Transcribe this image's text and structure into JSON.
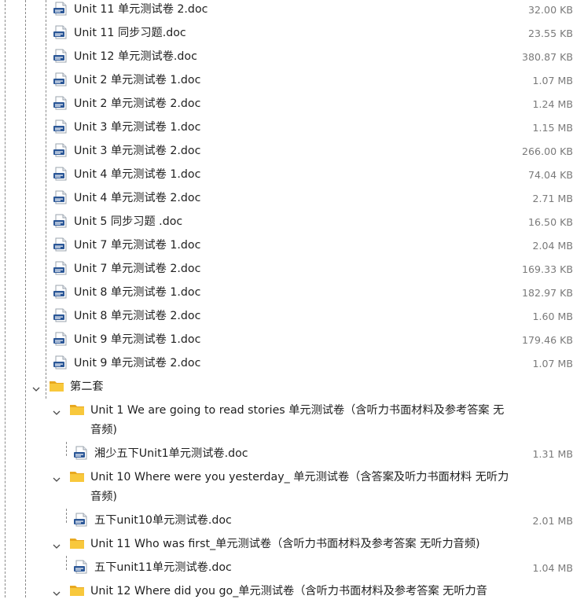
{
  "tree": {
    "items": [
      {
        "kind": "file",
        "depth": 2,
        "name": "Unit 11 单元测试卷 2.doc",
        "size": "32.00 KB"
      },
      {
        "kind": "file",
        "depth": 2,
        "name": "Unit 11 同步习题.doc",
        "size": "23.55 KB"
      },
      {
        "kind": "file",
        "depth": 2,
        "name": "Unit 12 单元测试卷.doc",
        "size": "380.87 KB"
      },
      {
        "kind": "file",
        "depth": 2,
        "name": "Unit 2 单元测试卷 1.doc",
        "size": "1.07 MB"
      },
      {
        "kind": "file",
        "depth": 2,
        "name": "Unit 2 单元测试卷 2.doc",
        "size": "1.24 MB"
      },
      {
        "kind": "file",
        "depth": 2,
        "name": "Unit 3 单元测试卷 1.doc",
        "size": "1.15 MB"
      },
      {
        "kind": "file",
        "depth": 2,
        "name": "Unit 3 单元测试卷 2.doc",
        "size": "266.00 KB"
      },
      {
        "kind": "file",
        "depth": 2,
        "name": "Unit 4 单元测试卷 1.doc",
        "size": "74.04 KB"
      },
      {
        "kind": "file",
        "depth": 2,
        "name": "Unit 4 单元测试卷 2.doc",
        "size": "2.71 MB"
      },
      {
        "kind": "file",
        "depth": 2,
        "name": "Unit 5 同步习题 .doc",
        "size": "16.50 KB"
      },
      {
        "kind": "file",
        "depth": 2,
        "name": "Unit 7 单元测试卷 1.doc",
        "size": "2.04 MB"
      },
      {
        "kind": "file",
        "depth": 2,
        "name": "Unit 7 单元测试卷 2.doc",
        "size": "169.33 KB"
      },
      {
        "kind": "file",
        "depth": 2,
        "name": "Unit 8 单元测试卷 1.doc",
        "size": "182.97 KB"
      },
      {
        "kind": "file",
        "depth": 2,
        "name": "Unit 8 单元测试卷 2.doc",
        "size": "1.60 MB"
      },
      {
        "kind": "file",
        "depth": 2,
        "name": "Unit 9 单元测试卷 1.doc",
        "size": "179.46 KB"
      },
      {
        "kind": "file",
        "depth": 2,
        "name": "Unit 9 单元测试卷 2.doc",
        "size": "1.07 MB"
      },
      {
        "kind": "folder",
        "depth": 1,
        "name": "第二套",
        "expanded": true
      },
      {
        "kind": "folder",
        "depth": 2,
        "name": "Unit 1 We are going to read stories 单元测试卷（含听力书面材料及参考答案 无",
        "name2": "音频)",
        "expanded": true
      },
      {
        "kind": "file",
        "depth": 3,
        "name": "湘少五下Unit1单元测试卷.doc",
        "size": "1.31 MB"
      },
      {
        "kind": "folder",
        "depth": 2,
        "name": "Unit 10 Where were you yesterday_ 单元测试卷（含答案及听力书面材料 无听力",
        "name2": "音频)",
        "expanded": true
      },
      {
        "kind": "file",
        "depth": 3,
        "name": "五下unit10单元测试卷.doc",
        "size": "2.01 MB"
      },
      {
        "kind": "folder",
        "depth": 2,
        "name": "Unit 11 Who was first_单元测试卷（含听力书面材料及参考答案 无听力音频)",
        "expanded": true
      },
      {
        "kind": "file",
        "depth": 3,
        "name": "五下unit11单元测试卷.doc",
        "size": "1.04 MB"
      },
      {
        "kind": "folder",
        "depth": 2,
        "name": "Unit 12 Where did you go_单元测试卷（含听力书面材料及参考答案 无听力音",
        "expanded": true
      }
    ]
  }
}
